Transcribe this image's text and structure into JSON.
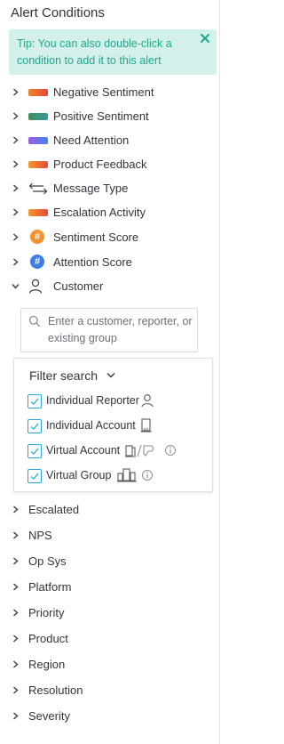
{
  "panel": {
    "title": "Alert Conditions",
    "tip": "Tip: You can also double-click a condition to add it to this alert",
    "colors": {
      "tip_bg": "#d3f1ea",
      "tip_text": "#1fa88a",
      "checkbox": "#27a9d6",
      "orange": "#f5922f",
      "blue": "#3d7de6"
    }
  },
  "conditions": [
    {
      "label": "Negative Sentiment",
      "icon": "gradient-bar-red-orange",
      "expanded": false
    },
    {
      "label": "Positive Sentiment",
      "icon": "gradient-bar-green-teal",
      "expanded": false
    },
    {
      "label": "Need Attention",
      "icon": "gradient-bar-purple-blue",
      "expanded": false
    },
    {
      "label": "Product Feedback",
      "icon": "gradient-bar-orange-red",
      "expanded": false
    },
    {
      "label": "Message Type",
      "icon": "arrows-left-right-icon",
      "expanded": false
    },
    {
      "label": "Escalation Activity",
      "icon": "gradient-bar-orange-red",
      "expanded": false
    },
    {
      "label": "Sentiment Score",
      "icon": "hash-orange-circle-icon",
      "glyph": "#",
      "expanded": false
    },
    {
      "label": "Attention Score",
      "icon": "hash-blue-circle-icon",
      "glyph": "#",
      "expanded": false
    },
    {
      "label": "Customer",
      "icon": "person-icon",
      "expanded": true
    }
  ],
  "customer_search": {
    "placeholder": "Enter a customer, reporter, or existing group"
  },
  "filter_search": {
    "label": "Filter search",
    "options": [
      {
        "label": "Individual Reporter",
        "checked": true,
        "icon": "person-icon"
      },
      {
        "label": "Individual Account",
        "checked": true,
        "icon": "building-icon"
      },
      {
        "label": "Virtual Account",
        "checked": true,
        "icon": "building-slash-tag-icon",
        "info": true
      },
      {
        "label": "Virtual Group",
        "checked": true,
        "icon": "buildings-group-icon",
        "info": true
      }
    ]
  },
  "other_conditions": [
    "Escalated",
    "NPS",
    "Op Sys",
    "Platform",
    "Priority",
    "Product",
    "Region",
    "Resolution",
    "Severity"
  ]
}
